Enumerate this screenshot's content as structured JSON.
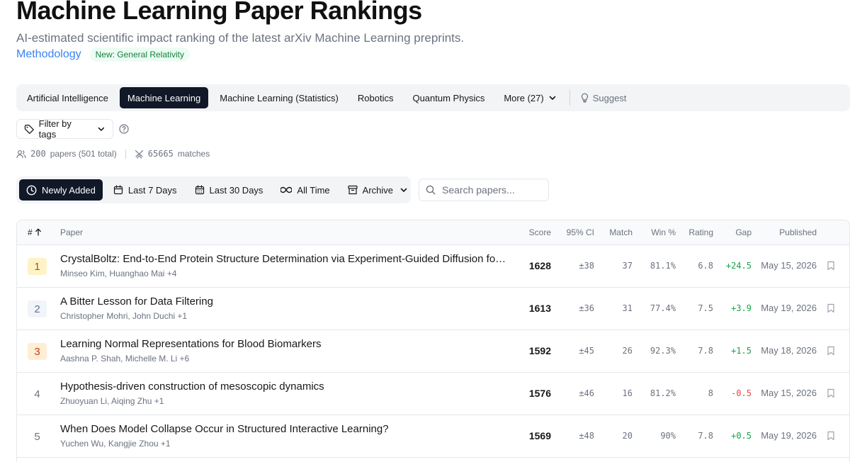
{
  "header": {
    "title": "Machine Learning Paper Rankings",
    "subtitle": "AI-estimated scientific impact ranking of the latest arXiv Machine Learning preprints.",
    "methodology_link": "Methodology",
    "new_badge": "New: General Relativity"
  },
  "categories": {
    "items": [
      {
        "label": "Artificial Intelligence",
        "active": false
      },
      {
        "label": "Machine Learning",
        "active": true
      },
      {
        "label": "Machine Learning (Statistics)",
        "active": false
      },
      {
        "label": "Robotics",
        "active": false
      },
      {
        "label": "Quantum Physics",
        "active": false
      }
    ],
    "more_label": "More (27)",
    "suggest_label": "Suggest"
  },
  "filter": {
    "label": "Filter by tags"
  },
  "stats": {
    "papers": "200",
    "papers_label": "papers (501 total)",
    "matches": "65665",
    "matches_label": "matches"
  },
  "time_filters": {
    "newly_added": "Newly Added",
    "last_7": "Last 7 Days",
    "last_30": "Last 30 Days",
    "all_time": "All Time",
    "archive": "Archive"
  },
  "search": {
    "placeholder": "Search papers..."
  },
  "table": {
    "columns": {
      "rank": "#",
      "paper": "Paper",
      "score": "Score",
      "ci": "95% CI",
      "match": "Match",
      "win": "Win %",
      "rating": "Rating",
      "gap": "Gap",
      "published": "Published"
    },
    "rows": [
      {
        "rank": "1",
        "title": "CrystalBoltz: End-to-End Protein Structure Determination via Experiment-Guided Diffusion for X...",
        "authors": "Minseo Kim, Huanghao Mai +4",
        "score": "1628",
        "ci": "±38",
        "match": "37",
        "win": "81.1%",
        "rating": "6.8",
        "gap": "+24.5",
        "published": "May 15, 2026"
      },
      {
        "rank": "2",
        "title": "A Bitter Lesson for Data Filtering",
        "authors": "Christopher Mohri, John Duchi +1",
        "score": "1613",
        "ci": "±36",
        "match": "31",
        "win": "77.4%",
        "rating": "7.5",
        "gap": "+3.9",
        "published": "May 19, 2026"
      },
      {
        "rank": "3",
        "title": "Learning Normal Representations for Blood Biomarkers",
        "authors": "Aashna P. Shah, Michelle M. Li +6",
        "score": "1592",
        "ci": "±45",
        "match": "26",
        "win": "92.3%",
        "rating": "7.8",
        "gap": "+1.5",
        "published": "May 18, 2026"
      },
      {
        "rank": "4",
        "title": "Hypothesis-driven construction of mesoscopic dynamics",
        "authors": "Zhuoyuan Li, Aiqing Zhu +1",
        "score": "1576",
        "ci": "±46",
        "match": "16",
        "win": "81.2%",
        "rating": "8",
        "gap": "-0.5",
        "published": "May 15, 2026"
      },
      {
        "rank": "5",
        "title": "When Does Model Collapse Occur in Structured Interactive Learning?",
        "authors": "Yuchen Wu, Kangjie Zhou +1",
        "score": "1569",
        "ci": "±48",
        "match": "20",
        "win": "90%",
        "rating": "7.8",
        "gap": "+0.5",
        "published": "May 19, 2026"
      }
    ],
    "rank_colors": {
      "1": {
        "bg": "#fef3c7",
        "fg": "#b45309"
      },
      "2": {
        "bg": "#f1f5f9",
        "fg": "#64748b"
      },
      "3": {
        "bg": "#ffedd5",
        "fg": "#c2410c"
      }
    }
  },
  "colors": {
    "accent_link": "#3b82f6",
    "active_bg": "#111827",
    "positive": "#16a34a",
    "negative": "#ef4444"
  }
}
